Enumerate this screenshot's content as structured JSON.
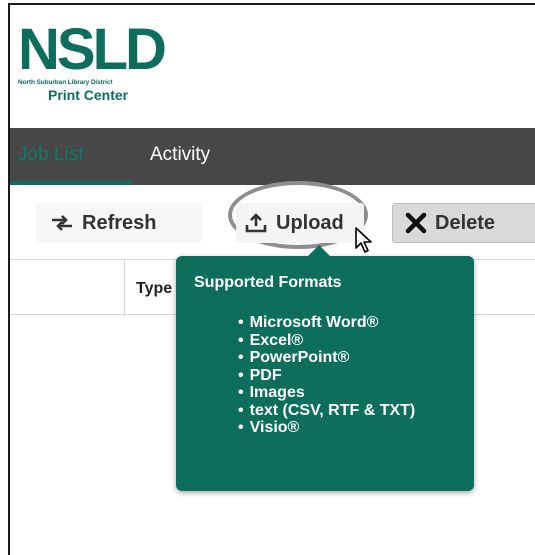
{
  "logo": {
    "main": "NSLD",
    "sub": "North Suburban Library District",
    "print": "Print Center"
  },
  "nav": {
    "tabs": [
      {
        "label": "Job List",
        "active": true
      },
      {
        "label": "Activity",
        "active": false
      }
    ]
  },
  "toolbar": {
    "refresh_label": "Refresh",
    "upload_label": "Upload",
    "delete_label": "Delete"
  },
  "table": {
    "columns": [
      "Type"
    ]
  },
  "tooltip": {
    "title": "Supported Formats",
    "items": [
      "Microsoft Word®",
      "Excel®",
      "PowerPoint®",
      "PDF",
      "Images",
      "text (CSV, RTF & TXT)",
      "Visio®"
    ]
  },
  "colors": {
    "brand": "#0e6e5c",
    "navbar": "#474747"
  }
}
